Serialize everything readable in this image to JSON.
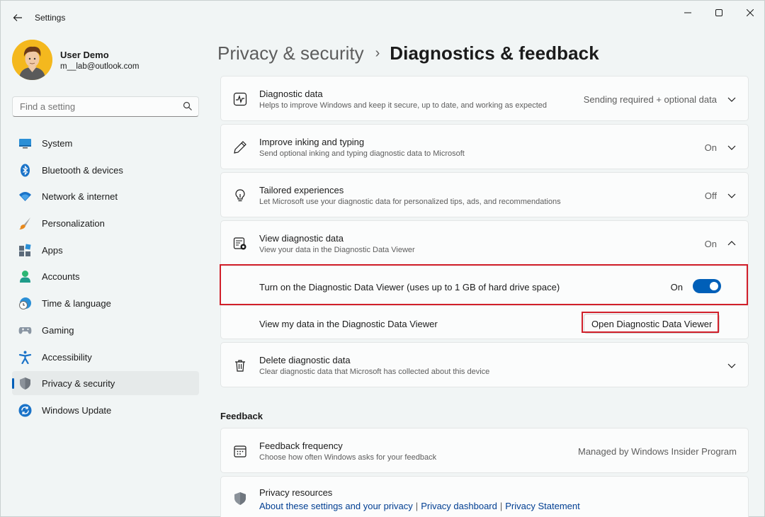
{
  "window": {
    "app_title": "Settings",
    "minimize": "minimize",
    "maximize": "maximize",
    "close": "close"
  },
  "user": {
    "name": "User Demo",
    "email": "m__lab@outlook.com"
  },
  "search": {
    "placeholder": "Find a setting"
  },
  "sidebar": {
    "items": [
      {
        "label": "System",
        "icon": "system-icon"
      },
      {
        "label": "Bluetooth & devices",
        "icon": "bluetooth-icon"
      },
      {
        "label": "Network & internet",
        "icon": "wifi-icon"
      },
      {
        "label": "Personalization",
        "icon": "brush-icon"
      },
      {
        "label": "Apps",
        "icon": "apps-icon"
      },
      {
        "label": "Accounts",
        "icon": "person-icon"
      },
      {
        "label": "Time & language",
        "icon": "clock-globe-icon"
      },
      {
        "label": "Gaming",
        "icon": "gamepad-icon"
      },
      {
        "label": "Accessibility",
        "icon": "accessibility-icon"
      },
      {
        "label": "Privacy & security",
        "icon": "shield-icon",
        "active": true
      },
      {
        "label": "Windows Update",
        "icon": "update-icon"
      }
    ]
  },
  "breadcrumb": {
    "parent": "Privacy & security",
    "separator": "›",
    "current": "Diagnostics & feedback"
  },
  "settings": {
    "diagnostic_data": {
      "title": "Diagnostic data",
      "desc": "Helps to improve Windows and keep it secure, up to date, and working as expected",
      "value": "Sending required + optional data"
    },
    "inking": {
      "title": "Improve inking and typing",
      "desc": "Send optional inking and typing diagnostic data to Microsoft",
      "value": "On"
    },
    "tailored": {
      "title": "Tailored experiences",
      "desc": "Let Microsoft use your diagnostic data for personalized tips, ads, and recommendations",
      "value": "Off"
    },
    "view_data": {
      "title": "View diagnostic data",
      "desc": "View your data in the Diagnostic Data Viewer",
      "value": "On",
      "toggle_label": "Turn on the Diagnostic Data Viewer (uses up to 1 GB of hard drive space)",
      "toggle_state": "On",
      "viewer_label": "View my data in the Diagnostic Data Viewer",
      "open_button": "Open Diagnostic Data Viewer"
    },
    "delete_data": {
      "title": "Delete diagnostic data",
      "desc": "Clear diagnostic data that Microsoft has collected about this device"
    }
  },
  "feedback": {
    "section_title": "Feedback",
    "frequency": {
      "title": "Feedback frequency",
      "desc": "Choose how often Windows asks for your feedback",
      "value": "Managed by Windows Insider Program"
    },
    "privacy_resources": {
      "title": "Privacy resources",
      "links": [
        "About these settings and your privacy",
        "Privacy dashboard",
        "Privacy Statement"
      ],
      "separator": "|"
    }
  },
  "colors": {
    "accent": "#005fb8",
    "highlight_box": "#d11f2a"
  }
}
